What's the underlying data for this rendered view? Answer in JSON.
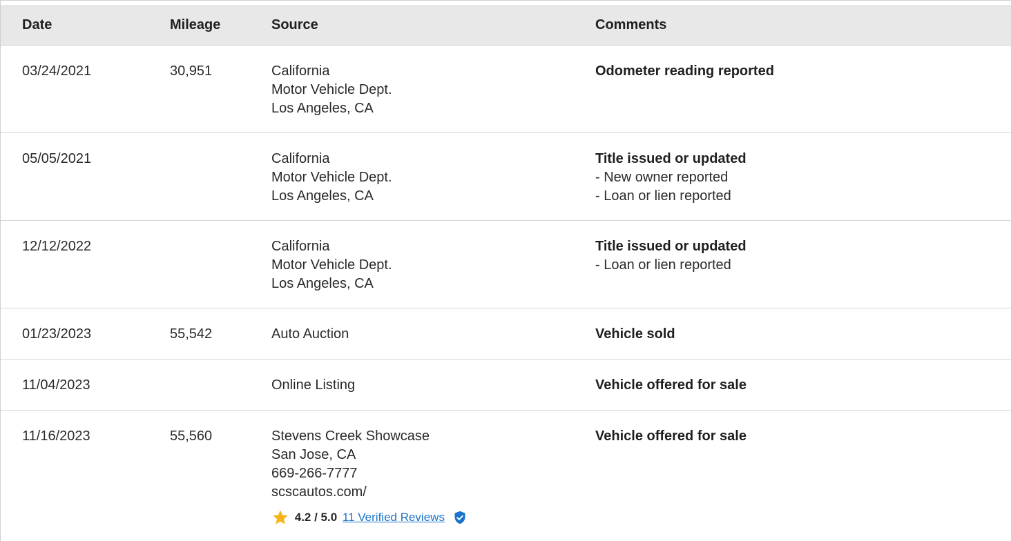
{
  "table": {
    "columns": {
      "date": "Date",
      "mileage": "Mileage",
      "source": "Source",
      "comments": "Comments"
    },
    "rows": [
      {
        "date": "03/24/2021",
        "mileage": "30,951",
        "source": [
          "California",
          "Motor Vehicle Dept.",
          "Los Angeles, CA"
        ],
        "comment_title": "Odometer reading reported",
        "comment_details": []
      },
      {
        "date": "05/05/2021",
        "mileage": "",
        "source": [
          "California",
          "Motor Vehicle Dept.",
          "Los Angeles, CA"
        ],
        "comment_title": "Title issued or updated",
        "comment_details": [
          "- New owner reported",
          "- Loan or lien reported"
        ]
      },
      {
        "date": "12/12/2022",
        "mileage": "",
        "source": [
          "California",
          "Motor Vehicle Dept.",
          "Los Angeles, CA"
        ],
        "comment_title": "Title issued or updated",
        "comment_details": [
          "- Loan or lien reported"
        ]
      },
      {
        "date": "01/23/2023",
        "mileage": "55,542",
        "source": [
          "Auto Auction"
        ],
        "comment_title": "Vehicle sold",
        "comment_details": []
      },
      {
        "date": "11/04/2023",
        "mileage": "",
        "source": [
          "Online Listing"
        ],
        "comment_title": "Vehicle offered for sale",
        "comment_details": []
      },
      {
        "date": "11/16/2023",
        "mileage": "55,560",
        "source": [
          "Stevens Creek Showcase",
          "San Jose, CA",
          "669-266-7777",
          "scscautos.com/"
        ],
        "comment_title": "Vehicle offered for sale",
        "comment_details": [],
        "rating": {
          "score": "4.2 / 5.0",
          "reviews_link": "11 Verified Reviews",
          "star_icon": "star-icon",
          "verified_icon": "verified-shield-icon"
        }
      }
    ]
  },
  "colors": {
    "header_bg": "#e8e8e8",
    "link": "#1a73c8",
    "star": "#f5b41a",
    "shield": "#1a73c8"
  }
}
